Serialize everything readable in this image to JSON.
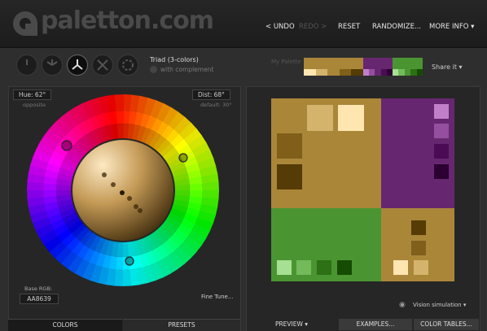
{
  "header": {
    "logo_text": "paletton.com",
    "nav": [
      {
        "label": "< UNDO",
        "enabled": true
      },
      {
        "label": "REDO >",
        "enabled": false
      },
      {
        "label": "RESET",
        "enabled": true
      },
      {
        "label": "RANDOMIZE...",
        "enabled": true
      },
      {
        "label": "MORE INFO ▾",
        "enabled": true
      }
    ]
  },
  "mode": {
    "label": "Triad (3-colors)",
    "complement_label": "with complement",
    "buttons": [
      "mono",
      "adjacent",
      "triad",
      "tetrad",
      "free"
    ],
    "selected": "triad"
  },
  "my_palette": {
    "label": "My Palette",
    "share_label": "Share it ▾",
    "groups": [
      {
        "main": "#aa8639",
        "shades": [
          "#ffe6b0",
          "#d4b46d",
          "#aa8639",
          "#7f5f19",
          "#553b06"
        ]
      },
      {
        "main": "#672770",
        "shades": [
          "#c17fca",
          "#954f9f",
          "#672770",
          "#4a0c53",
          "#2c0032"
        ]
      },
      {
        "main": "#4a9532",
        "shades": [
          "#a6e092",
          "#73ba5b",
          "#4a9532",
          "#2e7016",
          "#154b03"
        ]
      }
    ]
  },
  "wheel_panel": {
    "hue_label": "Hue: 62°",
    "hue_sub": "opposite",
    "dist_label": "Dist: 68°",
    "dist_sub": "default: 30°",
    "base_rgb_label": "Base RGB:",
    "base_rgb_value": "AA8639",
    "fine_tune_label": "Fine Tune..."
  },
  "left_tabs": [
    {
      "label": "COLORS",
      "active": false
    },
    {
      "label": "PRESETS",
      "active": true
    }
  ],
  "preview": {
    "colors": {
      "primary": "#aa8639",
      "secondary1": "#672770",
      "secondary2": "#4a9532",
      "p_light": "#d4b46d",
      "p_lightest": "#ffe6b0",
      "p_dark": "#7f5f19",
      "p_darkest": "#553b06",
      "s1_1": "#c17fca",
      "s1_2": "#954f9f",
      "s1_3": "#4a0c53",
      "s1_4": "#2c0032",
      "s2_1": "#a6e092",
      "s2_2": "#73ba5b",
      "s2_3": "#2e7016",
      "s2_4": "#154b03"
    },
    "vision_label": "Vision simulation ▾"
  },
  "bottom_tabs": [
    {
      "label": "PREVIEW ▾"
    },
    {
      "label": "EXAMPLES..."
    },
    {
      "label": "COLOR TABLES..."
    }
  ]
}
